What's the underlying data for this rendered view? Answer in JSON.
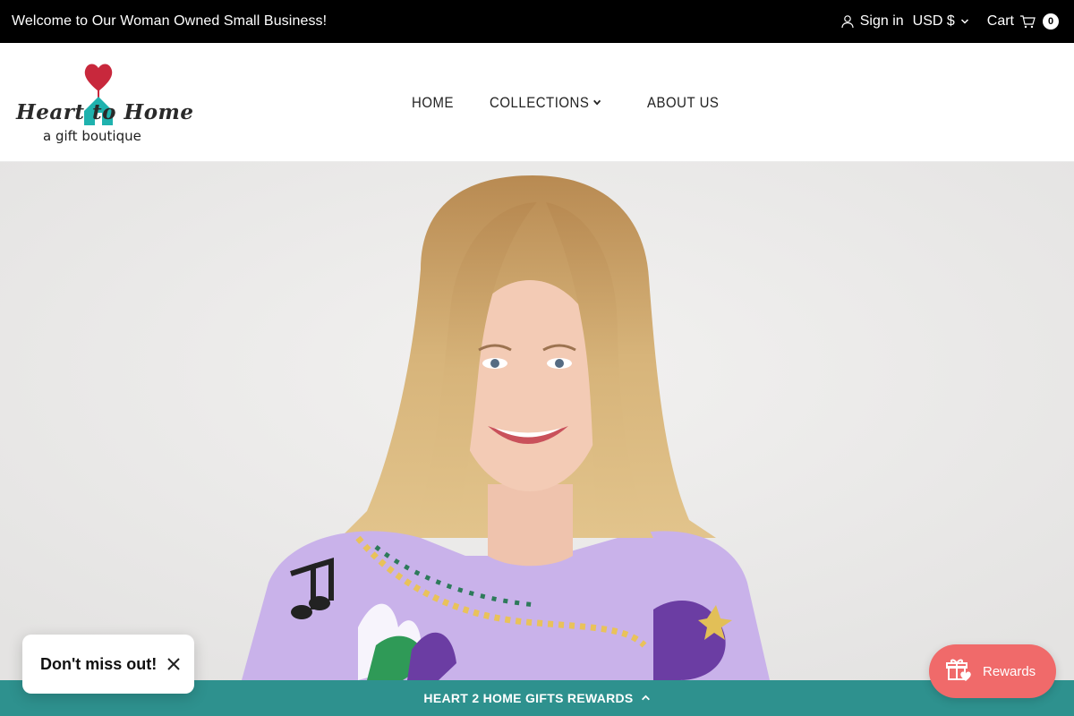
{
  "announcement": {
    "text": "Welcome to Our Woman Owned Small Business!",
    "sign_in": "Sign in",
    "currency": "USD $",
    "cart_label": "Cart",
    "cart_count": "0"
  },
  "logo": {
    "script_text": "Heart to Home",
    "tagline": "a gift boutique"
  },
  "nav": {
    "items": [
      {
        "label": "HOME"
      },
      {
        "label": "COLLECTIONS"
      },
      {
        "label": "ABOUT US"
      }
    ]
  },
  "popup": {
    "text": "Don't miss out!"
  },
  "rewards_bar": {
    "label": "HEART 2 HOME GIFTS REWARDS"
  },
  "launcher": {
    "label": "Rewards"
  },
  "colors": {
    "topbar": "#000000",
    "rewards_bar": "#2e918e",
    "launcher": "#f06a6a",
    "hero_background": "#ecebea"
  },
  "icons": [
    "user-icon",
    "chevron-down-icon",
    "cart-icon",
    "heart-icon",
    "house-icon",
    "close-icon",
    "chevron-up-icon",
    "gift-icon"
  ]
}
